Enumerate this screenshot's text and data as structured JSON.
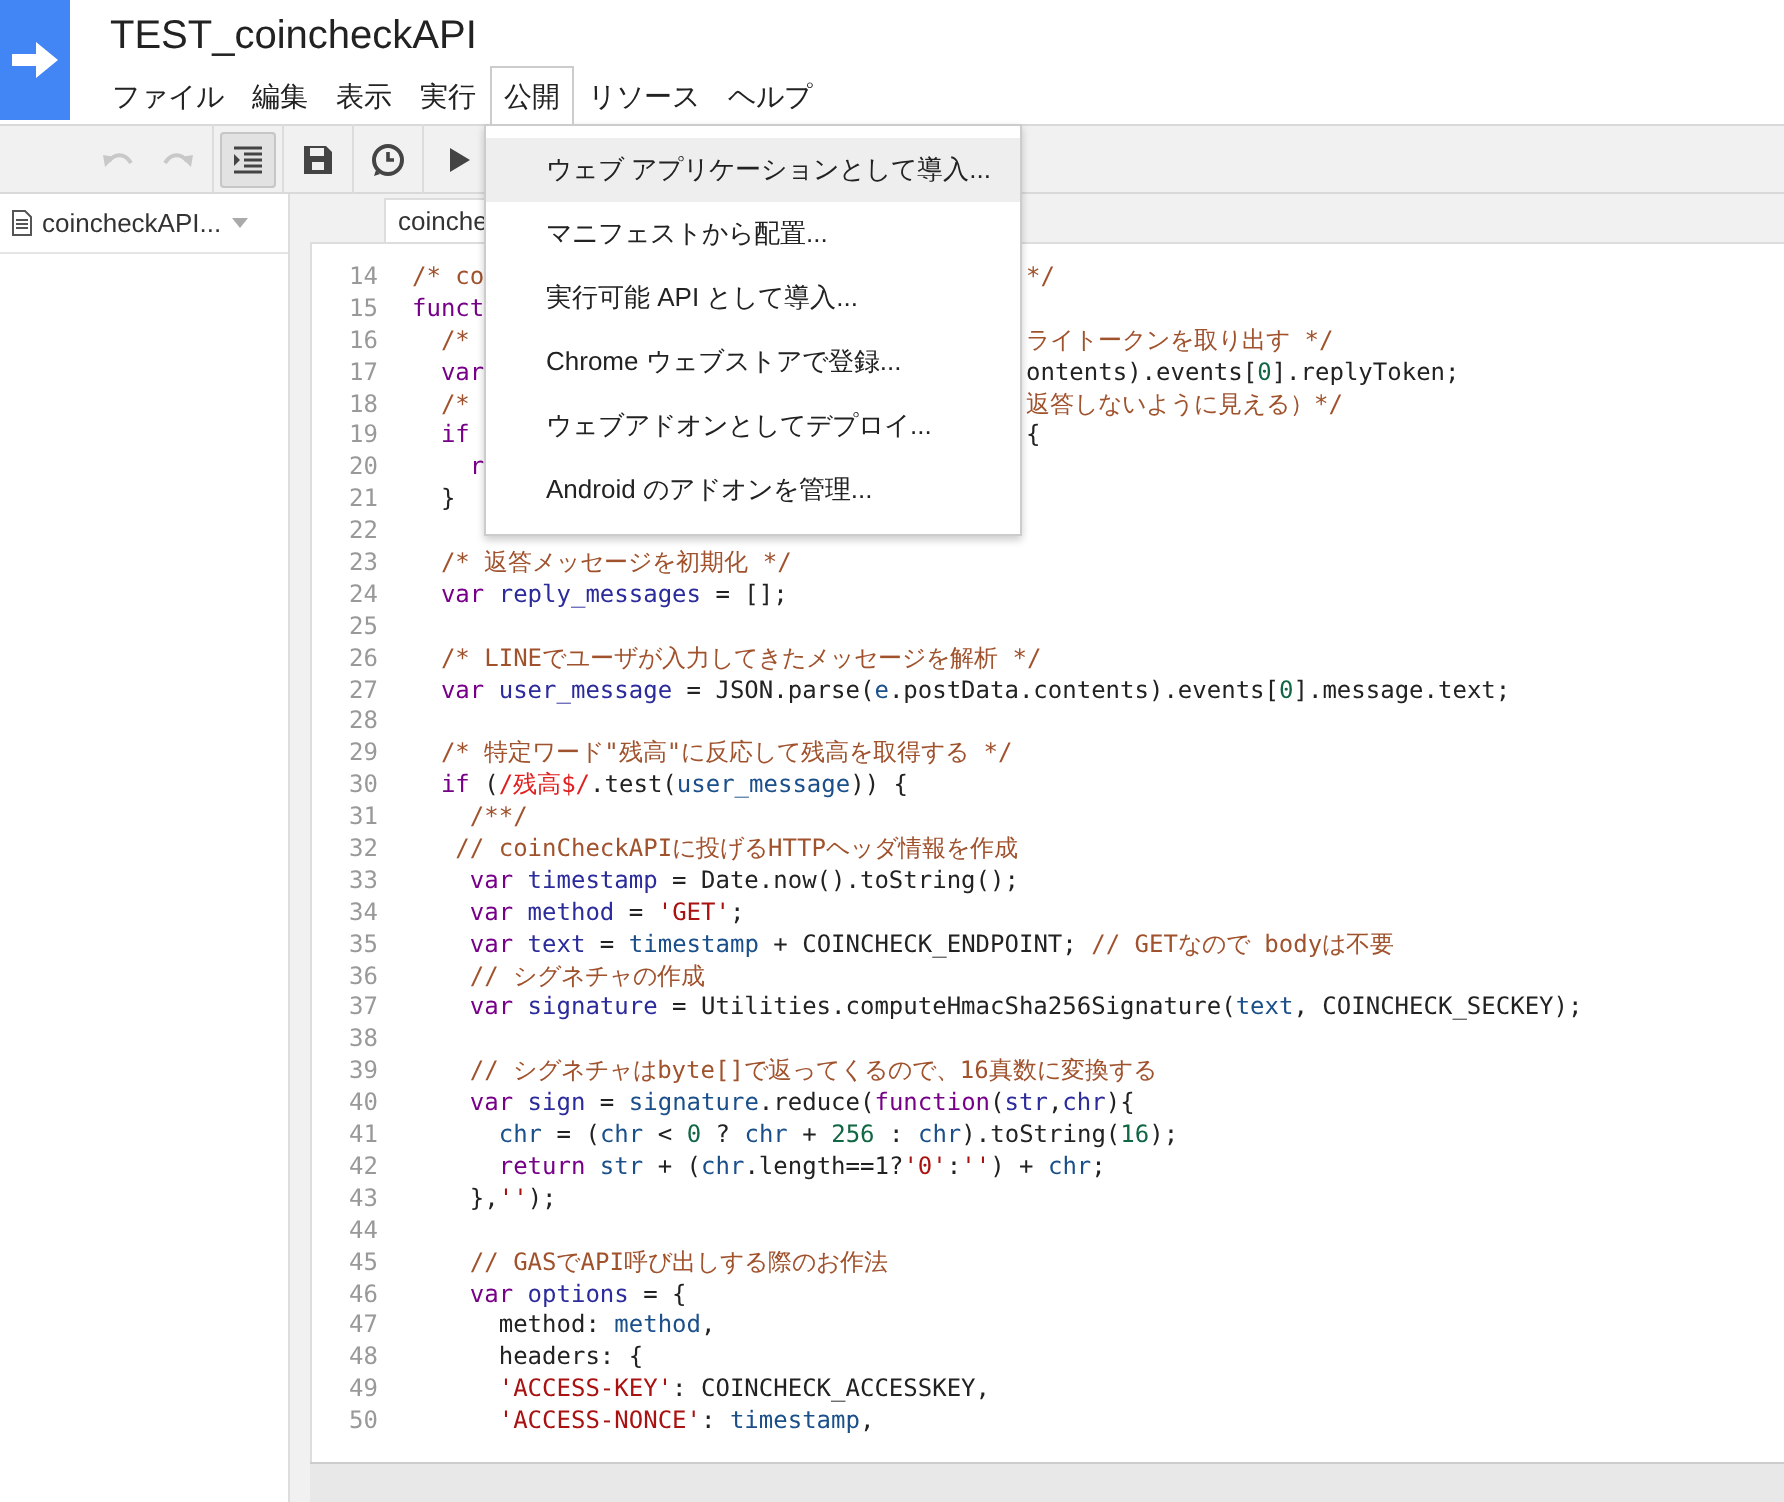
{
  "title": "TEST_coincheckAPI",
  "menu": [
    {
      "label": "ファイル",
      "selected": false
    },
    {
      "label": "編集",
      "selected": false
    },
    {
      "label": "表示",
      "selected": false
    },
    {
      "label": "実行",
      "selected": false
    },
    {
      "label": "公開",
      "selected": true
    },
    {
      "label": "リソース",
      "selected": false
    },
    {
      "label": "ヘルプ",
      "selected": false
    }
  ],
  "toolbar": [
    {
      "kind": "undo",
      "disabled": true,
      "pressed": false
    },
    {
      "kind": "redo",
      "disabled": true,
      "pressed": false
    },
    {
      "kind": "indent",
      "disabled": false,
      "pressed": true
    },
    {
      "kind": "save",
      "disabled": false,
      "pressed": false
    },
    {
      "kind": "triggers",
      "disabled": false,
      "pressed": false
    },
    {
      "kind": "run",
      "disabled": false,
      "pressed": false
    }
  ],
  "file_panel": {
    "file": "coincheckAPI..."
  },
  "tab": {
    "label": "coinche"
  },
  "dropdown": [
    {
      "label": "ウェブ アプリケーションとして導入...",
      "selected": true
    },
    {
      "label": "マニフェストから配置...",
      "selected": false
    },
    {
      "label": "実行可能 API として導入...",
      "selected": false
    },
    {
      "label": "Chrome ウェブストアで登録...",
      "selected": false
    },
    {
      "label": "ウェブアドオンとしてデプロイ...",
      "selected": false
    },
    {
      "label": "Android のアドオンを管理...",
      "selected": false
    }
  ],
  "code": [
    {
      "number": "14",
      "tokens": [
        {
          "kind": "comment",
          "text": "/* co"
        }
      ],
      "right": [
        {
          "kind": "comment",
          "text": "*/"
        }
      ]
    },
    {
      "number": "15",
      "tokens": [
        {
          "kind": "keyword",
          "text": "funct"
        }
      ]
    },
    {
      "number": "16",
      "tokens": [
        {
          "kind": "comment",
          "text": "  /*"
        }
      ],
      "right": [
        {
          "kind": "comment",
          "text": "ライトークンを取り出す */"
        }
      ]
    },
    {
      "number": "17",
      "tokens": [
        {
          "kind": "keyword",
          "text": "  var"
        }
      ],
      "right": [
        {
          "kind": "plain",
          "text": "ontents).events["
        },
        {
          "kind": "number",
          "text": "0"
        },
        {
          "kind": "plain",
          "text": "].replyToken;"
        }
      ]
    },
    {
      "number": "18",
      "tokens": [
        {
          "kind": "comment",
          "text": "  /*"
        }
      ],
      "right": [
        {
          "kind": "comment",
          "text": "返答しないように見える）*/"
        }
      ]
    },
    {
      "number": "19",
      "tokens": [
        {
          "kind": "keyword",
          "text": "  if"
        }
      ],
      "right": [
        {
          "kind": "plain",
          "text": "{"
        }
      ]
    },
    {
      "number": "20",
      "tokens": [
        {
          "kind": "keyword",
          "text": "    r"
        }
      ]
    },
    {
      "number": "21",
      "tokens": [
        {
          "kind": "plain",
          "text": "  }"
        }
      ]
    },
    {
      "number": "22"
    },
    {
      "number": "23",
      "tokens": [
        {
          "kind": "comment",
          "text": "  /* 返答メッセージを初期化 */"
        }
      ]
    },
    {
      "number": "24",
      "tokens": [
        {
          "kind": "keyword",
          "text": "  var"
        },
        {
          "kind": "def",
          "text": " reply_messages"
        },
        {
          "kind": "plain",
          "text": " = [];"
        }
      ]
    },
    {
      "number": "25"
    },
    {
      "number": "26",
      "tokens": [
        {
          "kind": "comment",
          "text": "  /* LINEでユーザが入力してきたメッセージを解析 */"
        }
      ]
    },
    {
      "number": "27",
      "tokens": [
        {
          "kind": "keyword",
          "text": "  var"
        },
        {
          "kind": "def",
          "text": " user_message"
        },
        {
          "kind": "plain",
          "text": " = JSON.parse("
        },
        {
          "kind": "variable",
          "text": "e"
        },
        {
          "kind": "plain",
          "text": ".postData.contents).events["
        },
        {
          "kind": "number",
          "text": "0"
        },
        {
          "kind": "plain",
          "text": "].message.text;"
        }
      ]
    },
    {
      "number": "28"
    },
    {
      "number": "29",
      "tokens": [
        {
          "kind": "comment",
          "text": "  /* 特定ワード\"残高\"に反応して残高を取得する */"
        }
      ]
    },
    {
      "number": "30",
      "tokens": [
        {
          "kind": "keyword",
          "text": "  if"
        },
        {
          "kind": "plain",
          "text": " ("
        },
        {
          "kind": "regex",
          "text": "/残高$/"
        },
        {
          "kind": "plain",
          "text": ".test("
        },
        {
          "kind": "variable",
          "text": "user_message"
        },
        {
          "kind": "plain",
          "text": ")) {"
        }
      ]
    },
    {
      "number": "31",
      "tokens": [
        {
          "kind": "comment",
          "text": "    /**/"
        }
      ]
    },
    {
      "number": "32",
      "tokens": [
        {
          "kind": "comment",
          "text": "   // coinCheckAPIに投げるHTTPヘッダ情報を作成"
        }
      ]
    },
    {
      "number": "33",
      "tokens": [
        {
          "kind": "keyword",
          "text": "    var"
        },
        {
          "kind": "def",
          "text": " timestamp"
        },
        {
          "kind": "plain",
          "text": " = Date.now().toString();"
        }
      ]
    },
    {
      "number": "34",
      "tokens": [
        {
          "kind": "keyword",
          "text": "    var"
        },
        {
          "kind": "def",
          "text": " method"
        },
        {
          "kind": "plain",
          "text": " = "
        },
        {
          "kind": "string",
          "text": "'GET'"
        },
        {
          "kind": "plain",
          "text": ";"
        }
      ]
    },
    {
      "number": "35",
      "tokens": [
        {
          "kind": "keyword",
          "text": "    var"
        },
        {
          "kind": "def",
          "text": " text"
        },
        {
          "kind": "plain",
          "text": " = "
        },
        {
          "kind": "variable",
          "text": "timestamp"
        },
        {
          "kind": "plain",
          "text": " + COINCHECK_ENDPOINT; "
        },
        {
          "kind": "comment",
          "text": "// GETなので bodyは不要"
        }
      ]
    },
    {
      "number": "36",
      "tokens": [
        {
          "kind": "comment",
          "text": "    // シグネチャの作成"
        }
      ]
    },
    {
      "number": "37",
      "tokens": [
        {
          "kind": "keyword",
          "text": "    var"
        },
        {
          "kind": "def",
          "text": " signature"
        },
        {
          "kind": "plain",
          "text": " = Utilities.computeHmacSha256Signature("
        },
        {
          "kind": "variable",
          "text": "text"
        },
        {
          "kind": "plain",
          "text": ", COINCHECK_SECKEY);"
        }
      ]
    },
    {
      "number": "38"
    },
    {
      "number": "39",
      "tokens": [
        {
          "kind": "comment",
          "text": "    // シグネチャはbyte[]で返ってくるので、16真数に変換する"
        }
      ]
    },
    {
      "number": "40",
      "tokens": [
        {
          "kind": "keyword",
          "text": "    var"
        },
        {
          "kind": "def",
          "text": " sign"
        },
        {
          "kind": "plain",
          "text": " = "
        },
        {
          "kind": "variable",
          "text": "signature"
        },
        {
          "kind": "plain",
          "text": ".reduce("
        },
        {
          "kind": "keyword",
          "text": "function"
        },
        {
          "kind": "plain",
          "text": "("
        },
        {
          "kind": "def",
          "text": "str"
        },
        {
          "kind": "plain",
          "text": ","
        },
        {
          "kind": "def",
          "text": "chr"
        },
        {
          "kind": "plain",
          "text": "){"
        }
      ]
    },
    {
      "number": "41",
      "tokens": [
        {
          "kind": "variable",
          "text": "      chr"
        },
        {
          "kind": "plain",
          "text": " = ("
        },
        {
          "kind": "variable",
          "text": "chr"
        },
        {
          "kind": "plain",
          "text": " < "
        },
        {
          "kind": "number",
          "text": "0"
        },
        {
          "kind": "plain",
          "text": " ? "
        },
        {
          "kind": "variable",
          "text": "chr"
        },
        {
          "kind": "plain",
          "text": " + "
        },
        {
          "kind": "number",
          "text": "256"
        },
        {
          "kind": "plain",
          "text": " : "
        },
        {
          "kind": "variable",
          "text": "chr"
        },
        {
          "kind": "plain",
          "text": ").toString("
        },
        {
          "kind": "number",
          "text": "16"
        },
        {
          "kind": "plain",
          "text": ");"
        }
      ]
    },
    {
      "number": "42",
      "tokens": [
        {
          "kind": "keyword",
          "text": "      return"
        },
        {
          "kind": "variable",
          "text": " str"
        },
        {
          "kind": "plain",
          "text": " + ("
        },
        {
          "kind": "variable",
          "text": "chr"
        },
        {
          "kind": "plain",
          "text": ".length==1?"
        },
        {
          "kind": "string",
          "text": "'0'"
        },
        {
          "kind": "plain",
          "text": ":"
        },
        {
          "kind": "string",
          "text": "''"
        },
        {
          "kind": "plain",
          "text": ") + "
        },
        {
          "kind": "variable",
          "text": "chr"
        },
        {
          "kind": "plain",
          "text": ";"
        }
      ]
    },
    {
      "number": "43",
      "tokens": [
        {
          "kind": "plain",
          "text": "    },"
        },
        {
          "kind": "string",
          "text": "''"
        },
        {
          "kind": "plain",
          "text": ");"
        }
      ]
    },
    {
      "number": "44"
    },
    {
      "number": "45",
      "tokens": [
        {
          "kind": "comment",
          "text": "    // GASでAPI呼び出しする際のお作法"
        }
      ]
    },
    {
      "number": "46",
      "tokens": [
        {
          "kind": "keyword",
          "text": "    var"
        },
        {
          "kind": "def",
          "text": " options"
        },
        {
          "kind": "plain",
          "text": " = {"
        }
      ]
    },
    {
      "number": "47",
      "tokens": [
        {
          "kind": "plain",
          "text": "      method: "
        },
        {
          "kind": "variable",
          "text": "method"
        },
        {
          "kind": "plain",
          "text": ","
        }
      ]
    },
    {
      "number": "48",
      "tokens": [
        {
          "kind": "plain",
          "text": "      headers: {"
        }
      ]
    },
    {
      "number": "49",
      "tokens": [
        {
          "kind": "string",
          "text": "      'ACCESS-KEY'"
        },
        {
          "kind": "plain",
          "text": ": COINCHECK_ACCESSKEY,"
        }
      ]
    },
    {
      "number": "50",
      "tokens": [
        {
          "kind": "string",
          "text": "      'ACCESS-NONCE'"
        },
        {
          "kind": "plain",
          "text": ": "
        },
        {
          "kind": "variable",
          "text": "timestamp"
        },
        {
          "kind": "plain",
          "text": ","
        }
      ]
    }
  ]
}
